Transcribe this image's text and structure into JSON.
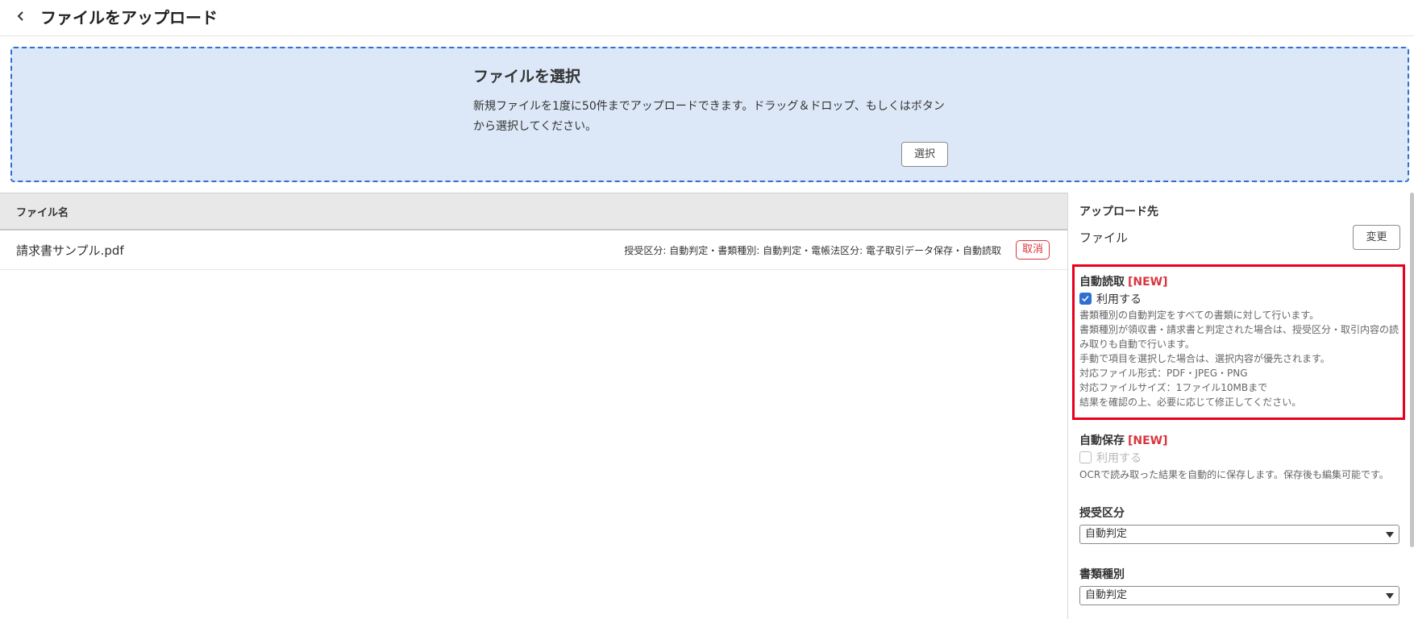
{
  "header": {
    "title": "ファイルをアップロード",
    "back_icon": "chevron-left-icon"
  },
  "dropzone": {
    "title": "ファイルを選択",
    "description_line1": "新規ファイルを1度に50件までアップロードできます。ドラッグ＆ドロップ、もしくはボタン",
    "description_line2": "から選択してください。",
    "select_label": "選択"
  },
  "table": {
    "columns": [
      "ファイル名"
    ],
    "rows": [
      {
        "filename": "請求書サンプル.pdf",
        "meta": "授受区分: 自動判定・書類種別: 自動判定・電帳法区分: 電子取引データ保存・自動読取",
        "cancel_label": "取消"
      }
    ]
  },
  "side_panel": {
    "destination_title": "アップロード先",
    "destination_value": "ファイル",
    "change_label": "変更",
    "auto_read": {
      "title": "自動読取",
      "new_badge": "[NEW]",
      "checkbox_label": "利用する",
      "checked": true,
      "help": [
        "書類種別の自動判定をすべての書類に対して行います。",
        "書類種別が領収書・請求書と判定された場合は、授受区分・取引内容の読",
        "み取りも自動で行います。",
        "手動で項目を選択した場合は、選択内容が優先されます。",
        "対応ファイル形式：PDF・JPEG・PNG",
        "対応ファイルサイズ：1ファイル10MBまで",
        "結果を確認の上、必要に応じて修正してください。"
      ]
    },
    "auto_save": {
      "title": "自動保存",
      "new_badge": "[NEW]",
      "checkbox_label": "利用する",
      "checked": false,
      "help": "OCRで読み取った結果を自動的に保存します。保存後も編集可能です。"
    },
    "transfer_type": {
      "label": "授受区分",
      "selected": "自動判定"
    },
    "document_type": {
      "label": "書類種別",
      "selected": "自動判定"
    }
  },
  "colors": {
    "accent": "#2f6fd1",
    "danger": "#d9363e",
    "dropzone_bg": "#dce8f8",
    "highlight_border": "#e8001c"
  }
}
